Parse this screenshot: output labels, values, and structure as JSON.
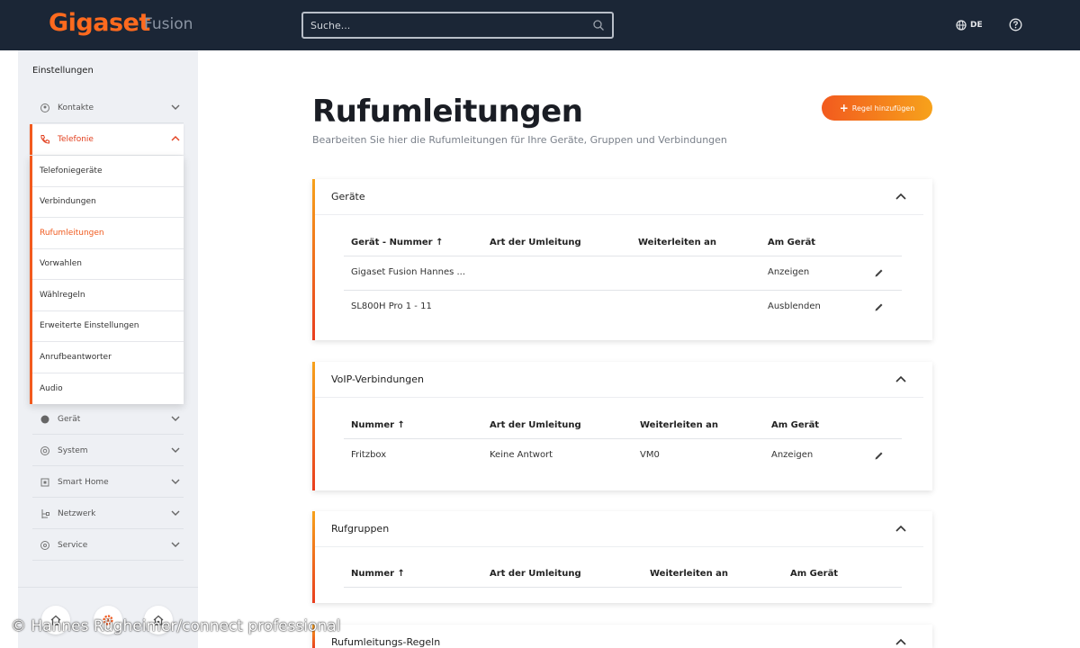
{
  "header": {
    "brand": "Gigaset",
    "product": "Fusion",
    "search_placeholder": "Suche...",
    "language": "DE"
  },
  "sidebar": {
    "title": "Einstellungen",
    "items": [
      {
        "label": "Kontakte",
        "icon": "contacts-icon"
      },
      {
        "label": "Telefonie",
        "icon": "phone-icon"
      },
      {
        "label": "Gerät",
        "icon": "device-icon"
      },
      {
        "label": "System",
        "icon": "system-icon"
      },
      {
        "label": "Smart Home",
        "icon": "smart-home-icon"
      },
      {
        "label": "Netzwerk",
        "icon": "network-icon"
      },
      {
        "label": "Service",
        "icon": "service-icon"
      }
    ],
    "submenu": [
      "Telefoniegeräte",
      "Verbindungen",
      "Rufumleitungen",
      "Vorwahlen",
      "Wählregeln",
      "Erweiterte Einstellungen",
      "Anrufbeantworter",
      "Audio"
    ],
    "active_submenu": "Rufumleitungen",
    "bottom_icons": [
      "home-icon",
      "settings-icon",
      "smart-home-icon"
    ]
  },
  "main": {
    "title": "Rufumleitungen",
    "subtitle": "Bearbeiten Sie hier die Rufumleitungen für Ihre Geräte, Gruppen und Verbindungen",
    "add_button": "Regel hinzufügen",
    "sections": [
      {
        "title": "Geräte",
        "columns": [
          "Gerät - Nummer",
          "Art der Umleitung",
          "Weiterleiten an",
          "Am Gerät"
        ],
        "rows": [
          [
            "Gigaset Fusion Hannes ...",
            "",
            "",
            "Anzeigen"
          ],
          [
            "SL800H Pro 1 - 11",
            "",
            "",
            "Ausblenden"
          ]
        ]
      },
      {
        "title": "VoIP-Verbindungen",
        "columns": [
          "Nummer",
          "Art der Umleitung",
          "Weiterleiten an",
          "Am Gerät"
        ],
        "rows": [
          [
            "Fritzbox",
            "Keine Antwort",
            "VM0",
            "Anzeigen"
          ]
        ]
      },
      {
        "title": "Rufgruppen",
        "columns": [
          "Nummer",
          "Art der Umleitung",
          "Weiterleiten an",
          "Am Gerät"
        ],
        "rows": []
      },
      {
        "title": "Rufumleitungs-Regeln",
        "columns": [],
        "rows": []
      }
    ],
    "sort_glyph": "↑"
  },
  "credit": "© Hannes Rügheimer/connect professional",
  "colors": {
    "header_bg": "#1b2636",
    "brand_orange": "#ff6a1e",
    "accent": "#f25a1e",
    "accent_end": "#f7a21b",
    "sidebar_bg": "#eef0f4"
  }
}
